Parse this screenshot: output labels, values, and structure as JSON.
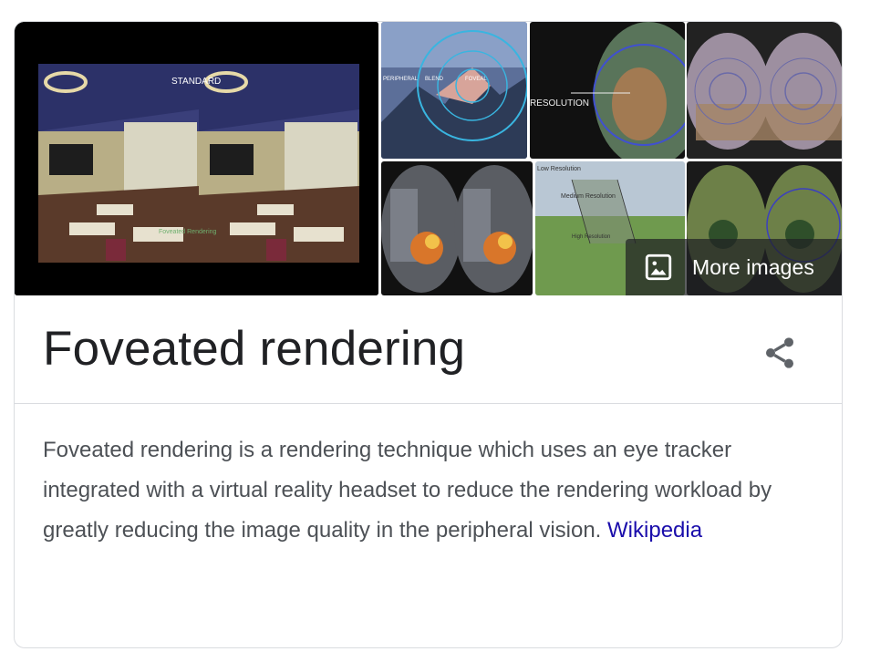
{
  "knowledge_panel": {
    "title": "Foveated rendering",
    "description": "Foveated rendering is a rendering technique which uses an eye tracker integrated with a virtual reality headset to reduce the rendering workload by greatly reducing the image quality in the peripheral vision.",
    "source_link": "Wikipedia",
    "more_images_label": "More images",
    "share_icon": "share-icon",
    "image_icon": "image-icon"
  },
  "gallery_text": {
    "main_standard": "STANDARD",
    "main_caption": "Foveated Rendering",
    "tile2_labels": [
      "PERIPHERAL",
      "BLEND",
      "FOVEAL"
    ],
    "tile3_label": "RESOLUTION",
    "tile6_labels": [
      "Low Resolution",
      "Medium Resolution",
      "High Resolution"
    ]
  },
  "colors": {
    "title": "#202124",
    "body_text": "#4d5156",
    "link": "#1a0dab",
    "border": "#dadce0"
  }
}
